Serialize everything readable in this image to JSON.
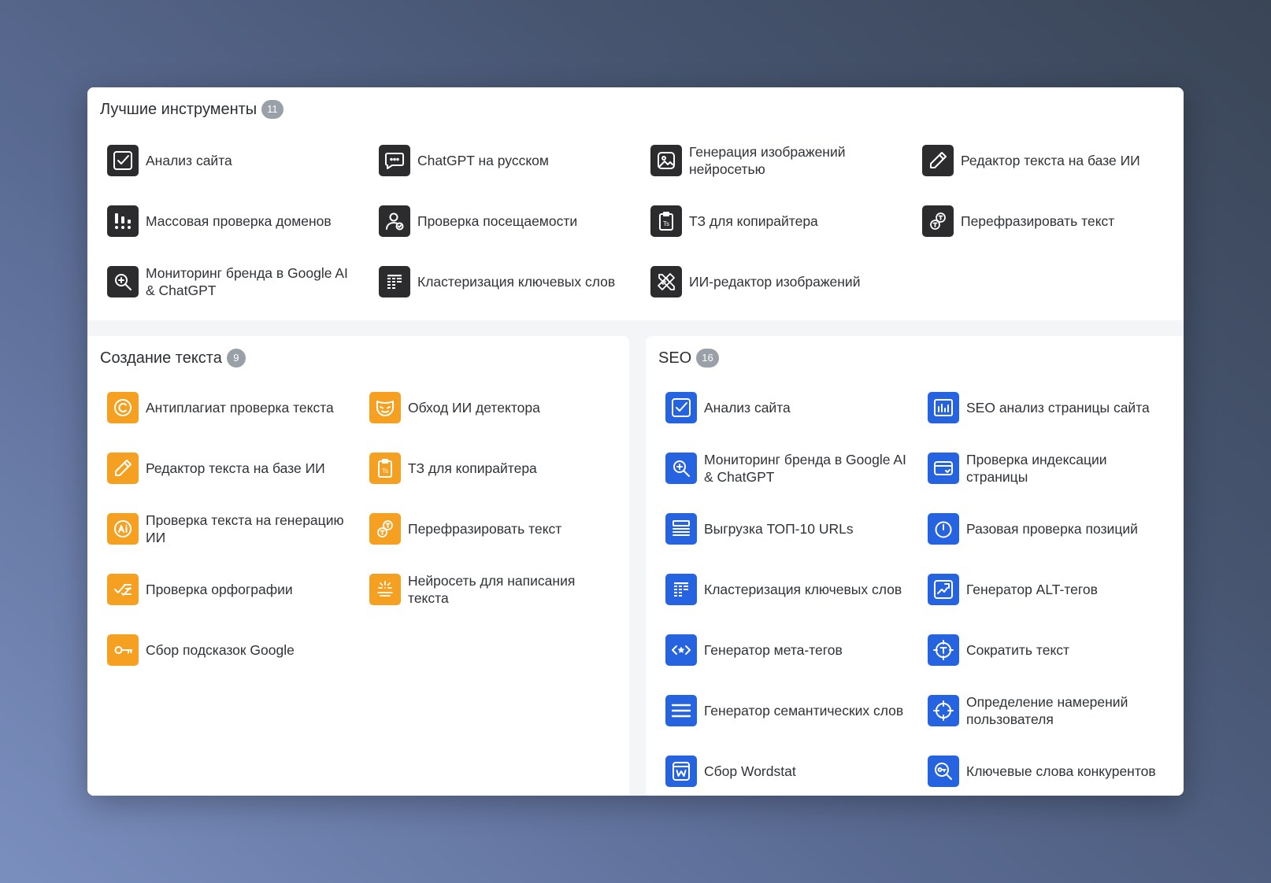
{
  "best": {
    "title": "Лучшие инструменты",
    "count": "11",
    "items": [
      {
        "label": "Анализ сайта",
        "icon": "check-icon"
      },
      {
        "label": "ChatGPT на русском",
        "icon": "chat-icon"
      },
      {
        "label": "Генерация изображений нейросетью",
        "icon": "image-icon"
      },
      {
        "label": "Редактор текста на базе ИИ",
        "icon": "pencil-icon"
      },
      {
        "label": "Массовая проверка доменов",
        "icon": "bars-dots-icon"
      },
      {
        "label": "Проверка посещаемости",
        "icon": "user-check-icon"
      },
      {
        "label": "ТЗ для копирайтера",
        "icon": "clipboard-ts-icon"
      },
      {
        "label": "Перефразировать текст",
        "icon": "paraphrase-icon"
      },
      {
        "label": "Мониторинг бренда в Google AI & ChatGPT",
        "icon": "search-plus-icon"
      },
      {
        "label": "Кластеризация ключевых слов",
        "icon": "cluster-list-icon"
      },
      {
        "label": "ИИ-редактор изображений",
        "icon": "ruler-pencil-icon"
      }
    ]
  },
  "text": {
    "title": "Создание текста",
    "count": "9",
    "items": [
      {
        "label": "Антиплагиат проверка текста",
        "icon": "copyright-icon"
      },
      {
        "label": "Обход ИИ детектора",
        "icon": "mask-icon"
      },
      {
        "label": "Редактор текста на базе ИИ",
        "icon": "pencil-icon"
      },
      {
        "label": "ТЗ для копирайтера",
        "icon": "clipboard-ts-icon"
      },
      {
        "label": "Проверка текста на генерацию ИИ",
        "icon": "ai-badge-icon"
      },
      {
        "label": "Перефразировать текст",
        "icon": "paraphrase-icon"
      },
      {
        "label": "Проверка орфографии",
        "icon": "spellcheck-icon"
      },
      {
        "label": "Нейросеть для написания текста",
        "icon": "magic-text-icon"
      },
      {
        "label": "Сбор подсказок Google",
        "icon": "key-list-icon"
      }
    ]
  },
  "seo": {
    "title": "SEO",
    "count": "16",
    "items": [
      {
        "label": "Анализ сайта",
        "icon": "check-icon"
      },
      {
        "label": "SEO анализ страницы сайта",
        "icon": "bar-chart-icon"
      },
      {
        "label": "Мониторинг бренда в Google AI & ChatGPT",
        "icon": "search-plus-icon"
      },
      {
        "label": "Проверка индексации страницы",
        "icon": "card-icon"
      },
      {
        "label": "Выгрузка ТОП-10 URLs",
        "icon": "list-lines-icon"
      },
      {
        "label": "Разовая проверка позиций",
        "icon": "gauge-icon"
      },
      {
        "label": "Кластеризация ключевых слов",
        "icon": "cluster-list-icon"
      },
      {
        "label": "Генератор ALT-тегов",
        "icon": "image-tag-icon"
      },
      {
        "label": "Генератор мета-тегов",
        "icon": "code-star-icon"
      },
      {
        "label": "Сократить текст",
        "icon": "target-t-icon"
      },
      {
        "label": "Генератор семантических слов",
        "icon": "menu-lines-icon"
      },
      {
        "label": "Определение намерений пользователя",
        "icon": "crosshair-icon"
      },
      {
        "label": "Сбор Wordstat",
        "icon": "wordstat-icon"
      },
      {
        "label": "Ключевые слова конкурентов",
        "icon": "key-search-icon"
      }
    ]
  },
  "colors": {
    "best_icon_bg": "#2c2c2e",
    "text_icon_bg": "#f5a020",
    "seo_icon_bg": "#2563e0"
  }
}
